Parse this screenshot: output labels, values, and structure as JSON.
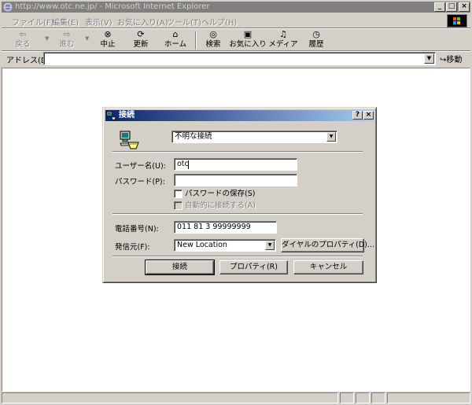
{
  "browser": {
    "title": "http://www.otc.ne.jp/ - Microsoft Internet Explorer",
    "menu": [
      "ファイル(F)",
      "編集(E)",
      "表示(V)",
      "お気に入り(A)",
      "ツール(T)",
      "ヘルプ(H)"
    ],
    "toolbar": {
      "back": "戻る",
      "forward": "進む",
      "stop": "中止",
      "refresh": "更新",
      "home": "ホーム",
      "search": "検索",
      "favorites": "お気に入り",
      "media": "メディア",
      "history": "履歴"
    },
    "address_label": "アドレス(D)",
    "address_value": "",
    "go_label": "移動"
  },
  "dialog": {
    "title": "接続",
    "connection_value": "不明な接続",
    "username_label": "ユーザー名(U):",
    "username_value": "otc",
    "password_label": "パスワード(P):",
    "password_value": "",
    "save_password_label": "パスワードの保存(S)",
    "auto_connect_label": "自動的に接続する(A)",
    "phone_label": "電話番号(N):",
    "phone_value": "011 81 3 99999999",
    "dial_from_label": "発信元(F):",
    "dial_from_value": "New Location",
    "dialing_properties_label": "ダイヤルのプロパティ(D)...",
    "connect_label": "接続",
    "properties_label": "プロパティ(R)",
    "cancel_label": "キャンセル"
  },
  "colors": {
    "inactive_title": "#808080",
    "active_title_start": "#0a246a",
    "active_title_end": "#a6caf0",
    "face": "#d4d0c8"
  }
}
